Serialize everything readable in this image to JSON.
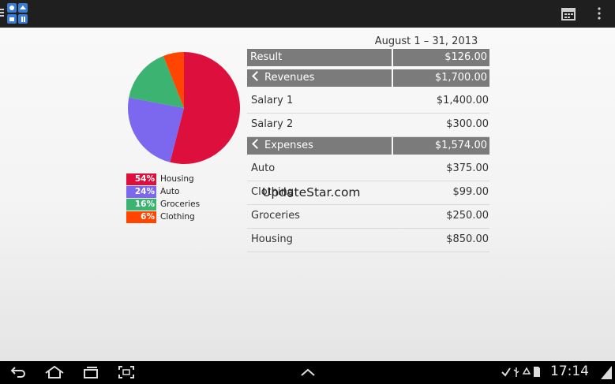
{
  "header": {
    "app_icon": "family-budget-app-icon",
    "calendar_icon": "calendar-icon",
    "overflow_icon": "overflow-menu-icon"
  },
  "date_range": "August 1 – 31, 2013",
  "pie": {
    "legend": [
      {
        "pct": "54%",
        "label": "Housing",
        "value": 54,
        "color": "#dd0f3d"
      },
      {
        "pct": "24%",
        "label": "Auto",
        "value": 24,
        "color": "#7b68ee"
      },
      {
        "pct": "16%",
        "label": "Groceries",
        "value": 16,
        "color": "#3cb371"
      },
      {
        "pct": "6%",
        "label": "Clothing",
        "value": 6,
        "color": "#ff4500"
      }
    ]
  },
  "report": {
    "result_label": "Result",
    "result_value": "$126.00",
    "revenues_label": "Revenues",
    "revenues_value": "$1,700.00",
    "revenues": [
      {
        "label": "Salary 1",
        "value": "$1,400.00"
      },
      {
        "label": "Salary 2",
        "value": "$300.00"
      }
    ],
    "expenses_label": "Expenses",
    "expenses_value": "$1,574.00",
    "expenses": [
      {
        "label": "Auto",
        "value": "$375.00"
      },
      {
        "label": "Clothing",
        "value": "$99.00"
      },
      {
        "label": "Groceries",
        "value": "$250.00"
      },
      {
        "label": "Housing",
        "value": "$850.00"
      }
    ]
  },
  "watermark": "UpdateStar.com",
  "systembar": {
    "time": "17:14",
    "nav_icons": [
      "back-icon",
      "home-icon",
      "recent-apps-icon",
      "screenshot-icon",
      "up-arrow-icon"
    ],
    "status_icons": [
      "check-icon",
      "usb-icon",
      "recycle-icon",
      "sd-card-icon",
      "signal-icon"
    ]
  }
}
